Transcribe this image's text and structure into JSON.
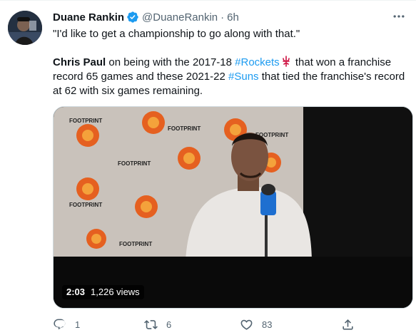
{
  "author": {
    "display_name": "Duane Rankin",
    "handle": "@DuaneRankin",
    "separator": "·",
    "time": "6h"
  },
  "tweet": {
    "quote": "\"I'd like to get a championship to go along with that.\"",
    "name_mention": "Chris Paul",
    "text_1": " on being with the 2017-18 ",
    "hashtag_1": "#Rockets",
    "text_2": " that won a franchise record 65 games and these 2021-22 ",
    "hashtag_2": "#Suns",
    "text_3": " that tied the franchise's record at 62 with six games remaining."
  },
  "video": {
    "duration": "2:03",
    "views": "1,226 views",
    "backdrop_text": "FOOTPRINT"
  },
  "actions": {
    "reply_count": "1",
    "retweet_count": "6",
    "like_count": "83"
  },
  "colors": {
    "link": "#1d9bf0",
    "secondary_text": "#536471",
    "primary_text": "#0f1419",
    "verified": "#1d9bf0",
    "rockets_red": "#ce1141",
    "suns_orange": "#e56020"
  }
}
